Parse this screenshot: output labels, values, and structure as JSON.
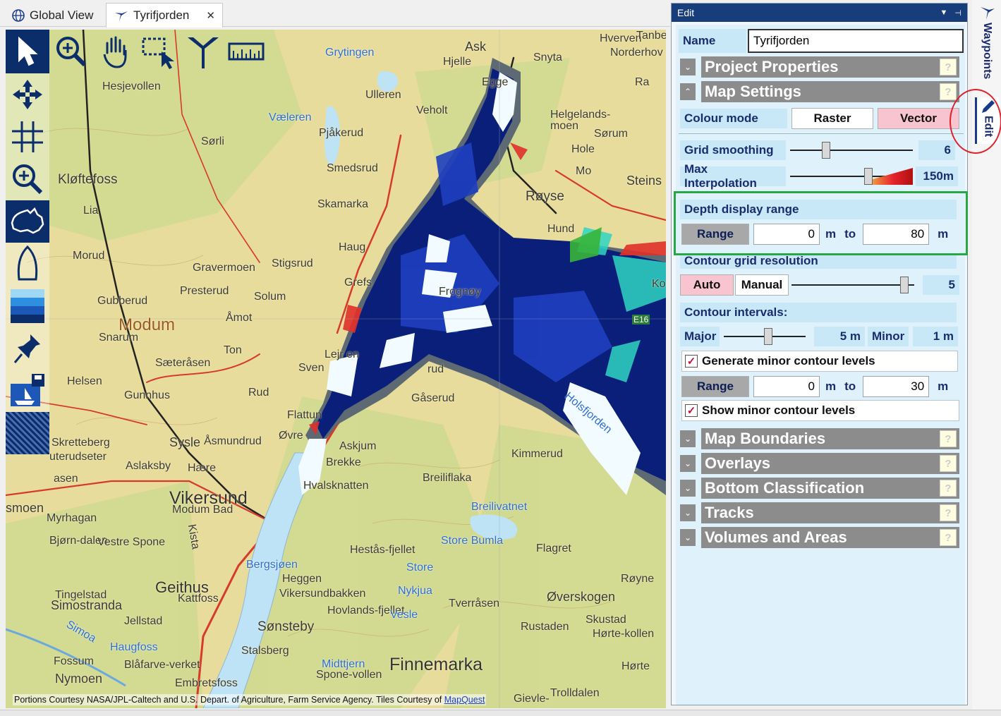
{
  "tabs": [
    {
      "label": "Global View",
      "icon": "globe-icon",
      "active": false
    },
    {
      "label": "Tyrifjorden",
      "icon": "boat-icon",
      "active": true
    }
  ],
  "map": {
    "attribution_text": "Portions Courtesy NASA/JPL-Caltech and U.S. Depart. of Agriculture, Farm Service Agency. Tiles Courtesy of ",
    "attribution_link": "MapQuest",
    "places": [
      {
        "t": "Hesjevollen"
      },
      {
        "t": "Kløftefoss"
      },
      {
        "t": "Lia"
      },
      {
        "t": "Morud"
      },
      {
        "t": "Gubberud"
      },
      {
        "t": "Modum"
      },
      {
        "t": "Snarum"
      },
      {
        "t": "Sæteråsen"
      },
      {
        "t": "Gunnhus"
      },
      {
        "t": "Helsen"
      },
      {
        "t": "Skretteberg"
      },
      {
        "t": "uterudseter"
      },
      {
        "t": "Aslaksby"
      },
      {
        "t": "Vikersund"
      },
      {
        "t": "Modum Bad"
      },
      {
        "t": "Myrhagan"
      },
      {
        "t": "Bjørn-dalen"
      },
      {
        "t": "Vestre Spone"
      },
      {
        "t": "Geithus"
      },
      {
        "t": "Kattfoss"
      },
      {
        "t": "Tingelstad"
      },
      {
        "t": "Simostranda"
      },
      {
        "t": "Jellstad"
      },
      {
        "t": "Haugfoss"
      },
      {
        "t": "Fossum"
      },
      {
        "t": "Nymoen"
      },
      {
        "t": "Blåfarve-verket"
      },
      {
        "t": "Embretsfoss"
      },
      {
        "t": "Sønsteby"
      },
      {
        "t": "Stalsberg"
      },
      {
        "t": "Bergsjøen"
      },
      {
        "t": "Heggen"
      },
      {
        "t": "Vikersundbakken"
      },
      {
        "t": "Hovlands-fjellet"
      },
      {
        "t": "Finnemarka"
      },
      {
        "t": "Midttjern"
      },
      {
        "t": "Spone-vollen"
      },
      {
        "t": "Hestås-fjellet"
      },
      {
        "t": "Store Bumla"
      },
      {
        "t": "Store"
      },
      {
        "t": "Nykjua"
      },
      {
        "t": "Vesle"
      },
      {
        "t": "Tverråsen"
      },
      {
        "t": "Rustaden"
      },
      {
        "t": "Flagret"
      },
      {
        "t": "Øverskogen"
      },
      {
        "t": "Røyne"
      },
      {
        "t": "Skustad"
      },
      {
        "t": "Hørte-kollen"
      },
      {
        "t": "Hørte"
      },
      {
        "t": "Trolldalen"
      },
      {
        "t": "Breiliflaka"
      },
      {
        "t": "Breilivatnet"
      },
      {
        "t": "Kimmerud"
      },
      {
        "t": "Gåserud"
      },
      {
        "t": "Askjum"
      },
      {
        "t": "Brekke"
      },
      {
        "t": "Hvalsknatten"
      },
      {
        "t": "Flattun"
      },
      {
        "t": "Øvre"
      },
      {
        "t": "Sysle"
      },
      {
        "t": "Åsmundrud"
      },
      {
        "t": "Hære"
      },
      {
        "t": "Rud"
      },
      {
        "t": "Ton"
      },
      {
        "t": "Åmot"
      },
      {
        "t": "Presterud"
      },
      {
        "t": "Solum"
      },
      {
        "t": "Gravermoen"
      },
      {
        "t": "Stigsrud"
      },
      {
        "t": "Haug"
      },
      {
        "t": "Skamarka"
      },
      {
        "t": "Smedsrud"
      },
      {
        "t": "Pjåkerud"
      },
      {
        "t": "Sørli"
      },
      {
        "t": "Væleren"
      },
      {
        "t": "Grytingen"
      },
      {
        "t": "Ulleren"
      },
      {
        "t": "Veholt"
      },
      {
        "t": "Ask"
      },
      {
        "t": "Hjelle"
      },
      {
        "t": "Snyta"
      },
      {
        "t": "Hverven"
      },
      {
        "t": "Tanbe"
      },
      {
        "t": "Norderhov"
      },
      {
        "t": "Helgelands-moen"
      },
      {
        "t": "Sørum"
      },
      {
        "t": "Hole"
      },
      {
        "t": "Mo"
      },
      {
        "t": "Røyse"
      },
      {
        "t": "Steins"
      },
      {
        "t": "Hund"
      },
      {
        "t": "Frognøy"
      },
      {
        "t": "Egge"
      },
      {
        "t": "Ra"
      },
      {
        "t": "E16"
      },
      {
        "t": "Ko"
      },
      {
        "t": "Grefs"
      },
      {
        "t": "Lejr en"
      },
      {
        "t": "Sven"
      },
      {
        "t": "rud"
      },
      {
        "t": "asen"
      },
      {
        "t": "smoen"
      },
      {
        "t": "Kista"
      },
      {
        "t": "Simoa"
      },
      {
        "t": "Holsfjorden"
      },
      {
        "t": "Gievle-"
      }
    ]
  },
  "toolbar": {
    "top": [
      "select-arrow-icon",
      "zoom-in-icon",
      "pan-hand-icon",
      "zoom-box-icon",
      "fork-icon",
      "ruler-icon"
    ],
    "left": [
      "move-arrows-icon",
      "grid-icon",
      "zoom-search-icon",
      "australia-map-icon",
      "boat-hull-icon",
      "depth-layers-icon",
      "pushpin-icon",
      "boat-save-icon",
      "dither-pattern-icon"
    ]
  },
  "panel": {
    "title": "Edit",
    "name_label": "Name",
    "name_value": "Tyrifjorden",
    "sections_collapsed_top": [
      {
        "label": "Project Properties",
        "expanded": false
      }
    ],
    "map_settings": {
      "label": "Map Settings",
      "expanded": true,
      "colour_mode_label": "Colour mode",
      "raster_label": "Raster",
      "vector_label": "Vector",
      "grid_smoothing_label": "Grid smoothing",
      "grid_smoothing_value": "6",
      "grid_smoothing_level": 0.28,
      "max_interp_label": "Max Interpolation",
      "max_interp_value": "150m",
      "max_interp_level": 0.65,
      "depth_range_label": "Depth display range",
      "range_label": "Range",
      "depth_from": "0",
      "depth_to": "80",
      "unit_m": "m",
      "to_label": "to",
      "contour_grid_label": "Contour grid resolution",
      "auto_label": "Auto",
      "manual_label": "Manual",
      "contour_grid_value": "5",
      "contour_grid_level": 0.95,
      "contour_intervals_label": "Contour intervals:",
      "major_label": "Major",
      "major_value": "5 m",
      "major_level": 0.55,
      "minor_label": "Minor",
      "minor_value": "1 m",
      "gen_minor_label": "Generate minor contour levels",
      "gen_minor_checked": true,
      "minor_range_label": "Range",
      "minor_from": "0",
      "minor_to": "30",
      "show_minor_label": "Show minor contour levels",
      "show_minor_checked": true
    },
    "sections_collapsed_bottom": [
      {
        "label": "Map Boundaries"
      },
      {
        "label": "Overlays"
      },
      {
        "label": "Bottom Classification"
      },
      {
        "label": "Tracks"
      },
      {
        "label": "Volumes and Areas"
      }
    ],
    "help_glyph": "?"
  },
  "side_tabs": [
    {
      "label": "Waypoints",
      "icon": "waypoint-pin-icon"
    },
    {
      "label": "Edit",
      "icon": "pencil-icon"
    }
  ],
  "colors": {
    "toolbar_active": "#0b2d6a",
    "panel_header": "#173e7a",
    "section_bar": "#8c8c8c",
    "pink_selected": "#f8c4cf",
    "label_text": "#1b2c6d",
    "highlight_green": "#28a745",
    "highlight_red": "#e0202a"
  }
}
